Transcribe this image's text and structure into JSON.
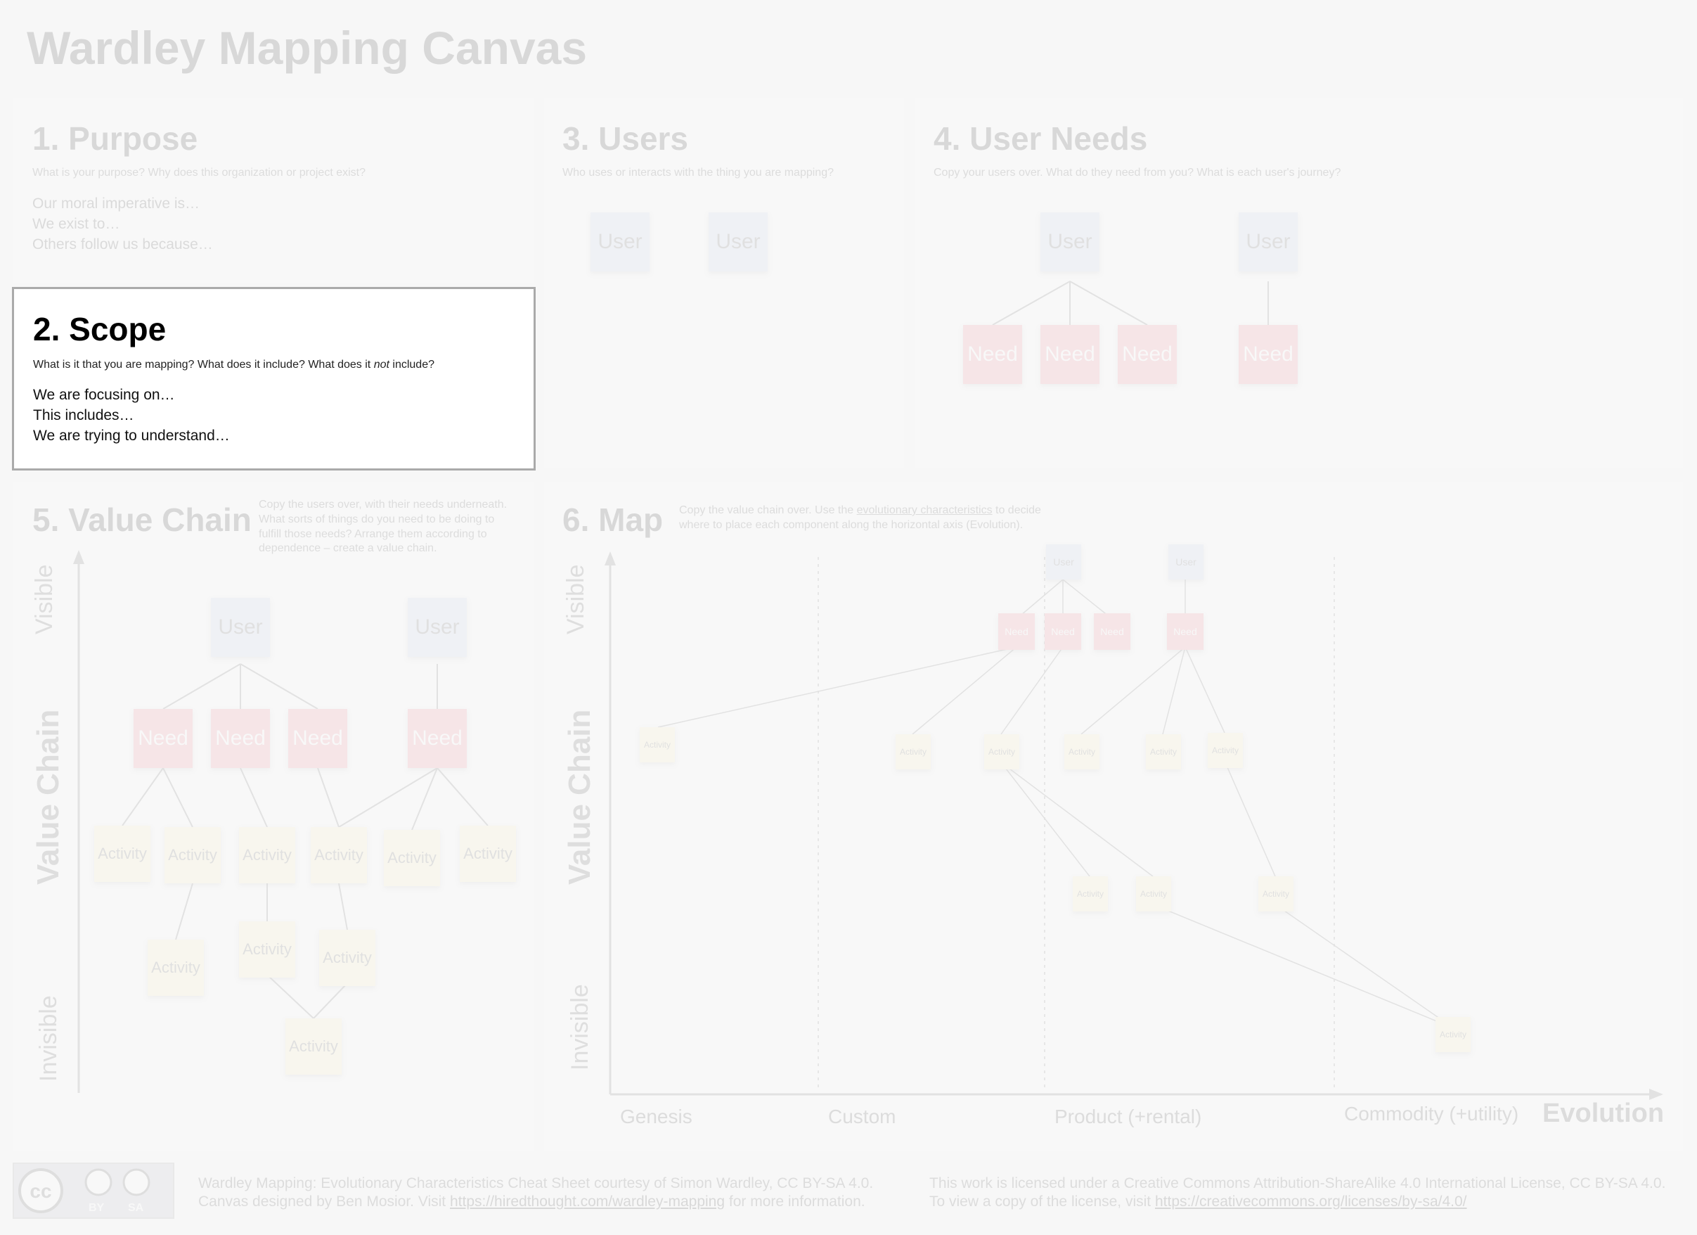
{
  "title": "Wardley Mapping Canvas",
  "purpose": {
    "heading": "1. Purpose",
    "question": "What is your purpose? Why does this organization or project exist?",
    "lines": [
      "Our moral imperative is…",
      "We exist to…",
      "Others follow us because…"
    ]
  },
  "scope": {
    "heading": "2. Scope",
    "question_a": "What is it that you are mapping? What does it include? What does it ",
    "question_em": "not",
    "question_b": " include?",
    "lines": [
      "We are focusing on…",
      "This includes…",
      "We are trying to understand…"
    ]
  },
  "users": {
    "heading": "3. Users",
    "question": "Who uses or interacts with the thing you are mapping?",
    "cards": [
      "User",
      "User"
    ]
  },
  "user_needs": {
    "heading": "4. User Needs",
    "question": "Copy your users over. What do they need from you? What is each user's journey?",
    "user_label": "User",
    "need_label": "Need"
  },
  "value_chain": {
    "heading": "5. Value Chain",
    "instructions": "Copy the users over, with their needs underneath. What sorts of things do you need to be doing to fulfill those needs? Arrange them according to dependence – create a value chain.",
    "axis_visible": "Visible",
    "axis_value_chain": "Value Chain",
    "axis_invisible": "Invisible",
    "user_label": "User",
    "need_label": "Need",
    "activity_label": "Activity"
  },
  "map": {
    "heading": "6. Map",
    "instructions_a": "Copy the value chain over. Use the ",
    "instructions_link": "evolutionary characteristics",
    "instructions_b": " to decide where to place each component along the horizontal axis (Evolution).",
    "axis_visible": "Visible",
    "axis_value_chain": "Value Chain",
    "axis_invisible": "Invisible",
    "stages": [
      "Genesis",
      "Custom",
      "Product (+rental)",
      "Commodity (+utility)"
    ],
    "evolution_label": "Evolution",
    "user_label": "User",
    "need_label": "Need",
    "activity_label": "Activity"
  },
  "footer": {
    "cc_labels": [
      "BY",
      "SA"
    ],
    "left_line1": "Wardley Mapping: Evolutionary Characteristics Cheat Sheet courtesy of Simon Wardley, CC BY-SA 4.0.",
    "left_line2_a": "Canvas designed by Ben Mosior. Visit ",
    "left_link": "https://hiredthought.com/wardley-mapping",
    "left_line2_b": " for more information.",
    "right_line1": "This work is licensed under a Creative Commons Attribution-ShareAlike 4.0 International License, CC BY-SA 4.0.",
    "right_line2_a": "To view a copy of the license, visit ",
    "right_link": "https://creativecommons.org/licenses/by-sa/4.0/"
  },
  "colors": {
    "user_card": "#bcc7e8",
    "need_card": "#ef6b77",
    "activity_card": "#fff3b0"
  }
}
